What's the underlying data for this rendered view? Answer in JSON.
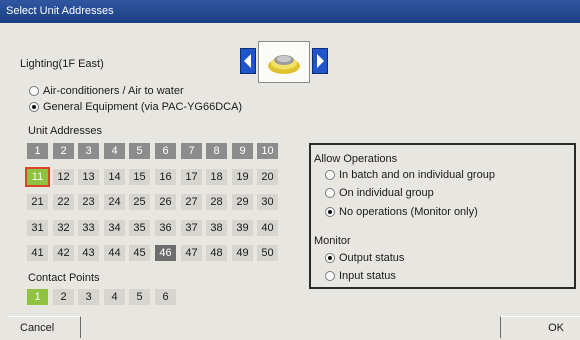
{
  "window": {
    "title": "Select Unit Addresses"
  },
  "device": {
    "name": "Lighting(1F East)",
    "icon": "lamp-icon"
  },
  "equipment_type": {
    "options": [
      {
        "label": "Air-conditioners / Air to water",
        "checked": false
      },
      {
        "label": "General Equipment (via PAC-YG66DCA)",
        "checked": true
      }
    ]
  },
  "unit_addresses": {
    "label": "Unit Addresses",
    "rows": [
      [
        "1",
        "2",
        "3",
        "4",
        "5",
        "6",
        "7",
        "8",
        "9",
        "10"
      ],
      [
        "11",
        "12",
        "13",
        "14",
        "15",
        "16",
        "17",
        "18",
        "19",
        "20"
      ],
      [
        "21",
        "22",
        "23",
        "24",
        "25",
        "26",
        "27",
        "28",
        "29",
        "30"
      ],
      [
        "31",
        "32",
        "33",
        "34",
        "35",
        "36",
        "37",
        "38",
        "39",
        "40"
      ],
      [
        "41",
        "42",
        "43",
        "44",
        "45",
        "46",
        "47",
        "48",
        "49",
        "50"
      ]
    ],
    "registered": [
      "1",
      "2",
      "3",
      "4",
      "5",
      "6",
      "7",
      "8",
      "9",
      "10",
      "46"
    ],
    "selected": "11"
  },
  "contact_points": {
    "label": "Contact Points",
    "items": [
      "1",
      "2",
      "3",
      "4",
      "5",
      "6"
    ],
    "on": [
      "1"
    ]
  },
  "allow_operations": {
    "label": "Allow Operations",
    "options": [
      {
        "label": "In batch and on individual group",
        "checked": false
      },
      {
        "label": "On individual group",
        "checked": false
      },
      {
        "label": "No operations (Monitor only)",
        "checked": true
      }
    ]
  },
  "monitor": {
    "label": "Monitor",
    "options": [
      {
        "label": "Output status",
        "checked": true
      },
      {
        "label": "Input status",
        "checked": false
      }
    ]
  },
  "buttons": {
    "cancel": "Cancel",
    "ok": "OK"
  },
  "colors": {
    "titlebar": "#1b3f86",
    "registered_cell": "#8c8c8c",
    "selected_cell": "#8fc33f",
    "selected_outline": "#d9452a",
    "nav_arrow": "#1f55c8"
  }
}
